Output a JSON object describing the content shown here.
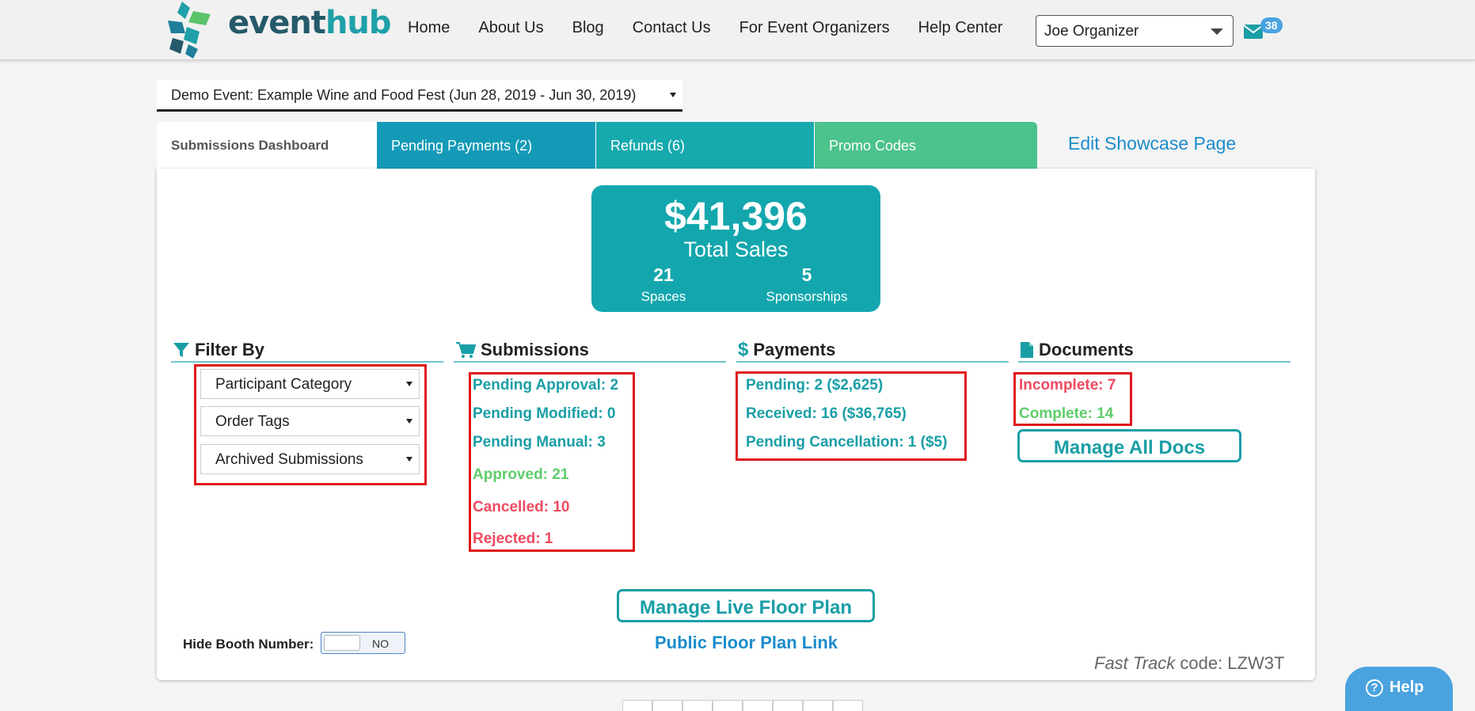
{
  "brand": {
    "name_part1": "event",
    "name_part2": "hub"
  },
  "nav": {
    "items": [
      {
        "label": "Home",
        "name": "nav-home"
      },
      {
        "label": "About Us",
        "name": "nav-about-us"
      },
      {
        "label": "Blog",
        "name": "nav-blog"
      },
      {
        "label": "Contact Us",
        "name": "nav-contact-us"
      },
      {
        "label": "For Event Organizers",
        "name": "nav-event-organizers"
      },
      {
        "label": "Help Center",
        "name": "nav-help-center"
      }
    ],
    "user": "Joe Organizer",
    "mail_count": "38"
  },
  "event_select": "Demo Event: Example Wine and Food Fest (Jun 28, 2019 - Jun 30, 2019)",
  "tabs": {
    "dashboard": "Submissions Dashboard",
    "pending_payments": "Pending Payments (2)",
    "refunds": "Refunds (6)",
    "promo_codes": "Promo Codes",
    "edit_showcase": "Edit Showcase Page"
  },
  "sales": {
    "amount": "$41,396",
    "label": "Total Sales",
    "spaces_count": "21",
    "spaces_label": "Spaces",
    "sponsorships_count": "5",
    "sponsorships_label": "Sponsorships"
  },
  "filter": {
    "title": "Filter By",
    "dropdowns": [
      "Participant Category",
      "Order Tags",
      "Archived Submissions"
    ]
  },
  "submissions": {
    "title": "Submissions",
    "pending_approval": "Pending Approval: 2",
    "pending_modified": "Pending Modified: 0",
    "pending_manual": "Pending Manual: 3",
    "approved": "Approved: 21",
    "cancelled": "Cancelled: 10",
    "rejected": "Rejected: 1"
  },
  "payments": {
    "title": "Payments",
    "pending": "Pending: 2 ($2,625)",
    "received": "Received: 16 ($36,765)",
    "pending_cancellation": "Pending Cancellation: 1 ($5)"
  },
  "documents": {
    "title": "Documents",
    "incomplete": "Incomplete: 7",
    "complete": "Complete: 14",
    "manage_button": "Manage All Docs"
  },
  "floor_plan": {
    "manage_button": "Manage Live Floor Plan",
    "public_link": "Public Floor Plan Link"
  },
  "hide_booth": {
    "label": "Hide Booth Number:",
    "toggle_value": "NO"
  },
  "fast_track": {
    "prefix": "Fast Track",
    "suffix": " code: LZW3T"
  },
  "help_button": "Help",
  "colors": {
    "teal": "#1a9ea6",
    "green": "#5fcc6a",
    "red": "#f04a60",
    "blue": "#149ab7"
  }
}
